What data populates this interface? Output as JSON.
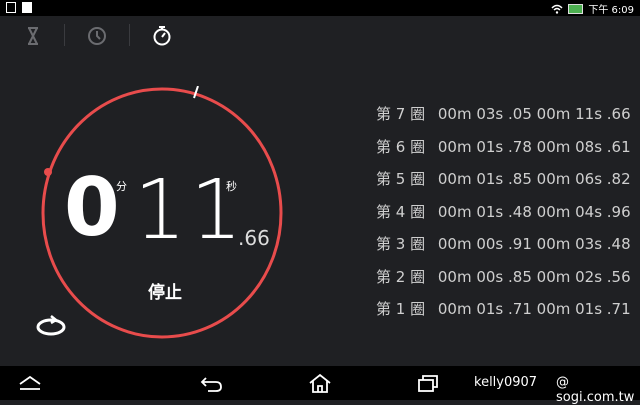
{
  "status_bar": {
    "time": "下午 6:09"
  },
  "tabs": [
    {
      "icon": "hourglass-icon"
    },
    {
      "icon": "clock-icon"
    },
    {
      "icon": "stopwatch-icon",
      "active": true
    }
  ],
  "stopwatch": {
    "minutes": "0",
    "minutes_unit": "分",
    "seconds": "11",
    "seconds_unit": "秒",
    "fraction": ".66",
    "stop_label": "停止",
    "accent_color": "#e84c4c"
  },
  "laps": [
    {
      "label": "第 7 圈",
      "lap_time": "00m 03s .05",
      "total_time": "00m 11s .66"
    },
    {
      "label": "第 6 圈",
      "lap_time": "00m 01s .78",
      "total_time": "00m 08s .61"
    },
    {
      "label": "第 5 圈",
      "lap_time": "00m 01s .85",
      "total_time": "00m 06s .82"
    },
    {
      "label": "第 4 圈",
      "lap_time": "00m 01s .48",
      "total_time": "00m 04s .96"
    },
    {
      "label": "第 3 圈",
      "lap_time": "00m 00s .91",
      "total_time": "00m 03s .48"
    },
    {
      "label": "第 2 圈",
      "lap_time": "00m 00s .85",
      "total_time": "00m 02s .56"
    },
    {
      "label": "第 1 圈",
      "lap_time": "00m 01s .71",
      "total_time": "00m 01s .71"
    }
  ],
  "watermark": {
    "left": "kelly0907",
    "right": "@ sogi.com.tw"
  }
}
